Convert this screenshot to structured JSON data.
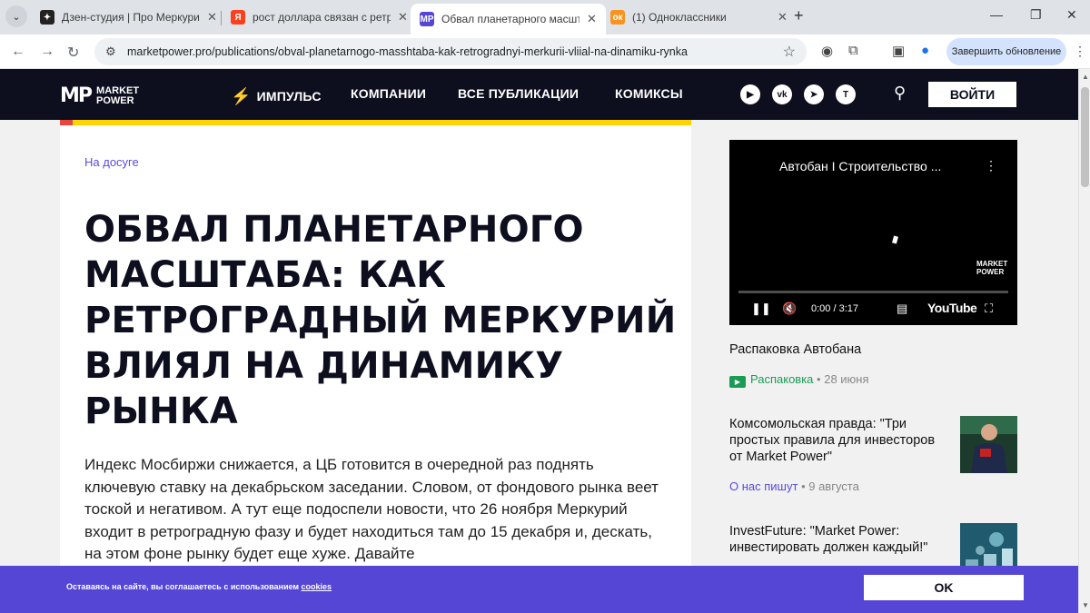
{
  "browser": {
    "tabs": [
      {
        "title": "Дзен-студия | Про Меркурий",
        "icon": "zen-studio-icon"
      },
      {
        "title": "рост доллара связан с ретрогр",
        "icon": "yandex-icon"
      },
      {
        "title": "Обвал планетарного масштаб",
        "icon": "marketpower-icon",
        "active": true
      },
      {
        "title": "(1) Одноклассники",
        "icon": "odnoklassniki-icon"
      }
    ],
    "url": "marketpower.pro/publications/obval-planetarnogo-masshtaba-kak-retrogradnyi-merkurii-vliial-na-dinamiku-rynka",
    "update_label": "Завершить обновление"
  },
  "site": {
    "logo_mark": "MP",
    "logo_text_line1": "MARKET",
    "logo_text_line2": "POWER",
    "nav": [
      "ИМПУЛЬС",
      "КОМПАНИИ",
      "ВСЕ ПУБЛИКАЦИИ",
      "КОМИКСЫ"
    ],
    "login_label": "ВОЙТИ",
    "accent_color": "#5546d6",
    "header_color": "#0d0e1e"
  },
  "article": {
    "category": "На досуге",
    "headline": "Обвал планетарного масштаба: как ретроградный Меркурий влиял на динамику рынка",
    "lead": "Индекс Мосбиржи снижается, а ЦБ готовится в очередной раз поднять ключевую ставку на декабрьском заседании. Словом, от фондового рынка веет тоской и негативом. А тут еще подоспели новости, что 26 ноября Меркурий входит в ретроградную фазу и будет находиться там до 15 декабря и, дескать, на этом фоне рынку будет еще хуже. Давайте"
  },
  "video": {
    "title": "Автобан I Строительство ...",
    "logo_line1": "MARKET",
    "logo_line2": "POWER",
    "time": "0:00 / 3:17",
    "brand": "YouTube"
  },
  "sidebar": {
    "items": [
      {
        "title": "Распаковка Автобана",
        "category": "Распаковка",
        "date": "28 июня"
      },
      {
        "title": "Комсомольская правда: \"Три простых правила для инвесторов от Market Power\"",
        "category": "О нас пишут",
        "date": "9 августа"
      },
      {
        "title": "InvestFuture: \"Market Power: инвестировать должен каждый!\""
      }
    ]
  },
  "cookie": {
    "text": "Оставаясь на сайте, вы соглашаетесь с использованием",
    "link": "cookies",
    "ok_label": "OK"
  }
}
